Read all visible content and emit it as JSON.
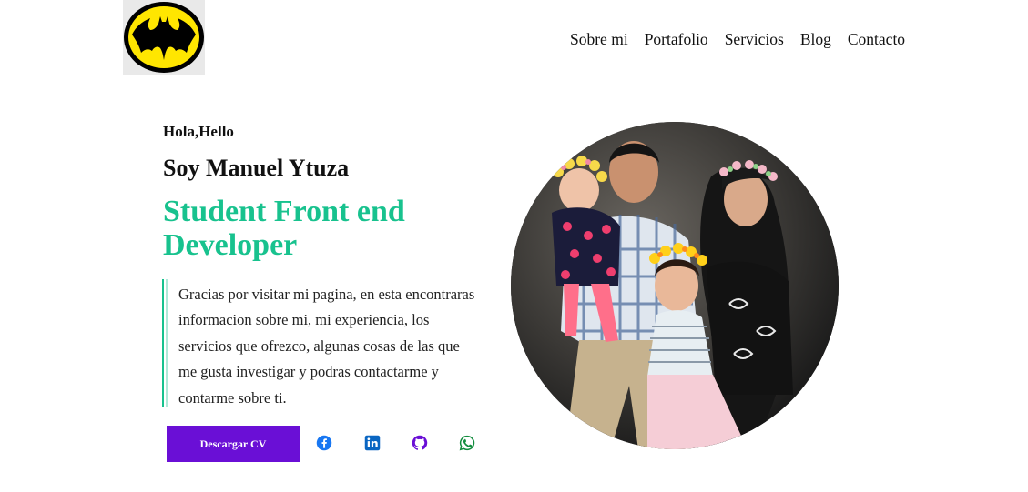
{
  "header": {
    "logo": "batman-logo",
    "nav": [
      "Sobre mi",
      "Portafolio",
      "Servicios",
      "Blog",
      "Contacto"
    ]
  },
  "hero": {
    "greeting": "Hola,Hello",
    "name": "Soy Manuel Ytuza",
    "role": "Student Front end Developer",
    "bio": "Gracias por visitar mi pagina, en esta encontraras informacion sobre mi, mi experiencia, los servicios que ofrezco, algunas cosas de las que me gusta investigar y podras contactarme y contarme sobre ti.",
    "cv_button": "Descargar CV",
    "accent_color": "#18c28e",
    "button_color": "#6a0fd6"
  },
  "social": [
    {
      "icon": "facebook-icon",
      "color": "#1877f2"
    },
    {
      "icon": "linkedin-icon",
      "color": "#0a66c2"
    },
    {
      "icon": "github-icon",
      "color": "#6a0fd6"
    },
    {
      "icon": "whatsapp-icon",
      "color": "#128c3e"
    }
  ],
  "photo": {
    "subject": "family-photo"
  }
}
